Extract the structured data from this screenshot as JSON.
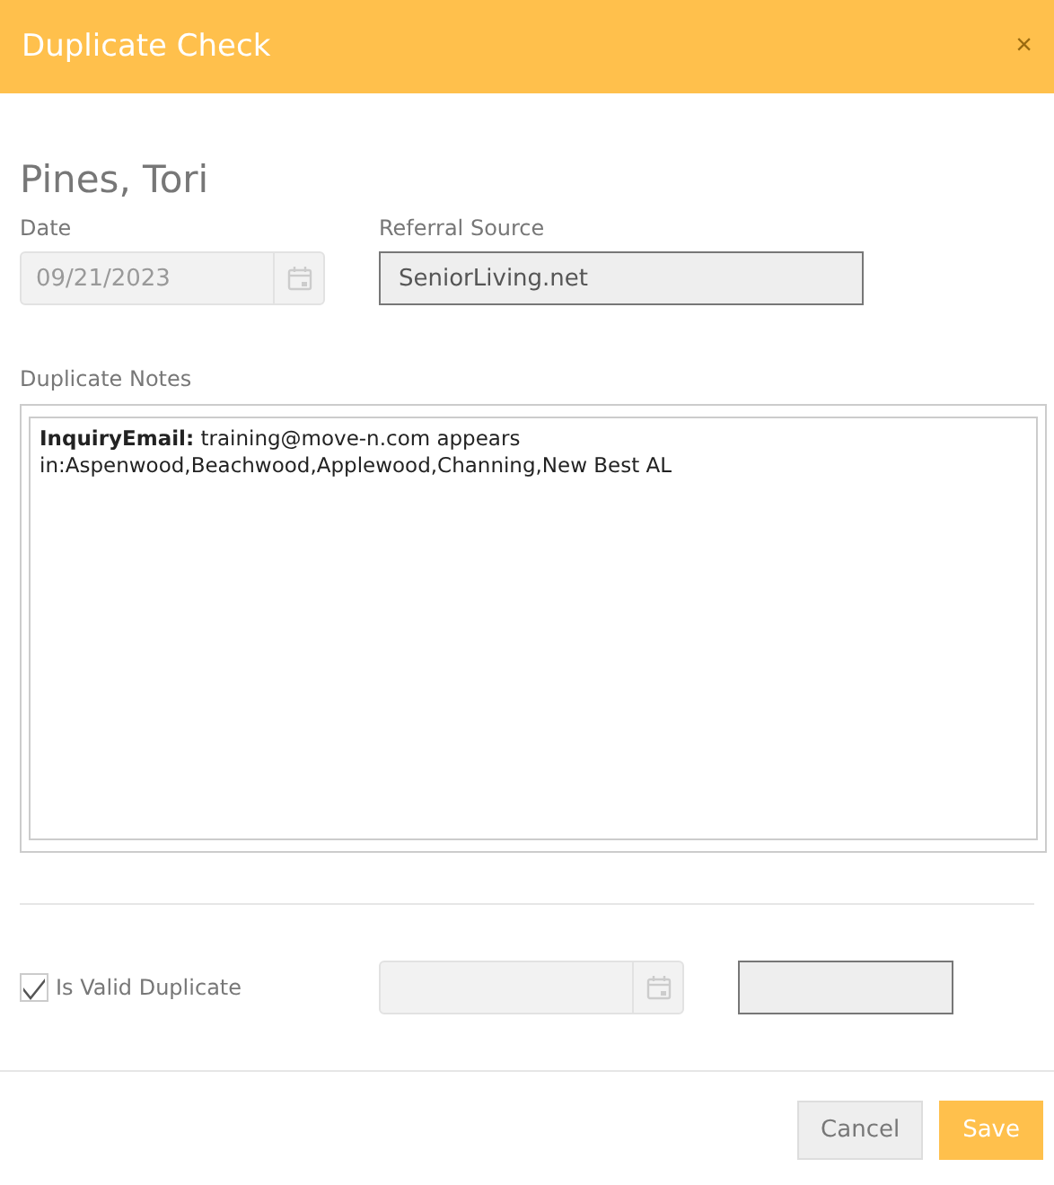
{
  "dialog": {
    "title": "Duplicate Check",
    "close": "×"
  },
  "person": {
    "name": "Pines, Tori"
  },
  "date": {
    "label": "Date",
    "value": "09/21/2023",
    "disabled": true
  },
  "referral_source": {
    "label": "Referral Source",
    "value": "SeniorLiving.net"
  },
  "duplicate_notes": {
    "label": "Duplicate Notes",
    "value": "**InquiryEmail:** training@move-n.com appears\nin:Aspenwood,Beachwood,Applewood,Channing,New Best AL"
  },
  "valid_duplicate": {
    "label": "Is Valid Duplicate",
    "checked": true
  },
  "buttons": [
    {
      "label": "Cancel",
      "kind": "secondary"
    },
    {
      "label": "Save",
      "kind": "primary"
    }
  ]
}
